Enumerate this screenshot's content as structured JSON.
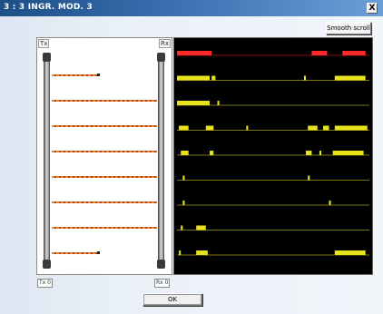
{
  "window": {
    "title": "3 : 3 INGR. MOD. 3",
    "close_label": "X"
  },
  "toolbar": {
    "smooth_scroll_label": "Smooth scroll"
  },
  "barrier": {
    "tx_label": "Tx",
    "rx_label": "Rx",
    "beam_count": 9,
    "colors": {
      "beam_orange": "#e08a1e",
      "beam_red": "#b53a2a"
    }
  },
  "status": {
    "tx_value": "Tx 0",
    "rx_value": "Rx 0"
  },
  "scope": {
    "channels": [
      {
        "color": "#ff2a2a",
        "segments": [
          [
            0.0,
            0.18
          ],
          [
            0.7,
            0.78
          ],
          [
            0.86,
            0.98
          ]
        ]
      },
      {
        "color": "#e8e21c",
        "segments": [
          [
            0.0,
            0.17
          ],
          [
            0.18,
            0.2
          ],
          [
            0.66,
            0.67
          ],
          [
            0.82,
            0.98
          ]
        ]
      },
      {
        "color": "#e8e21c",
        "segments": [
          [
            0.0,
            0.17
          ],
          [
            0.21,
            0.22
          ]
        ]
      },
      {
        "color": "#e8e21c",
        "segments": [
          [
            0.01,
            0.06
          ],
          [
            0.15,
            0.19
          ],
          [
            0.36,
            0.37
          ],
          [
            0.68,
            0.73
          ],
          [
            0.76,
            0.79
          ],
          [
            0.82,
            0.99
          ]
        ]
      },
      {
        "color": "#e8e21c",
        "segments": [
          [
            0.02,
            0.06
          ],
          [
            0.17,
            0.19
          ],
          [
            0.67,
            0.7
          ],
          [
            0.74,
            0.75
          ],
          [
            0.81,
            0.97
          ]
        ]
      },
      {
        "color": "#e8e21c",
        "segments": [
          [
            0.03,
            0.04
          ],
          [
            0.68,
            0.69
          ]
        ]
      },
      {
        "color": "#e8e21c",
        "segments": [
          [
            0.03,
            0.04
          ],
          [
            0.79,
            0.8
          ]
        ]
      },
      {
        "color": "#e8e21c",
        "segments": [
          [
            0.02,
            0.03
          ],
          [
            0.1,
            0.15
          ]
        ]
      },
      {
        "color": "#e8e21c",
        "segments": [
          [
            0.01,
            0.02
          ],
          [
            0.1,
            0.16
          ],
          [
            0.82,
            0.98
          ]
        ]
      }
    ]
  },
  "actions": {
    "ok_label": "OK"
  }
}
